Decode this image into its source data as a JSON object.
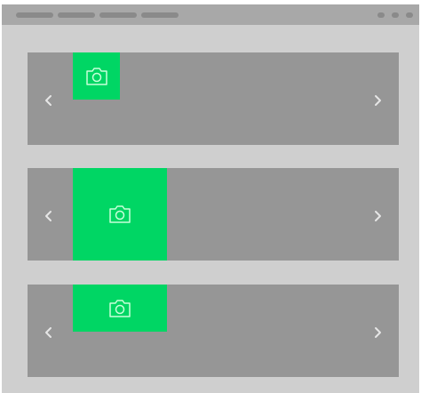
{
  "window": {
    "titlebar": {
      "tabs": [
        {
          "icon": "placeholder-tab"
        },
        {
          "icon": "placeholder-tab"
        },
        {
          "icon": "placeholder-tab"
        },
        {
          "icon": "placeholder-tab"
        }
      ],
      "controls": [
        {
          "icon": "window-control-dot"
        },
        {
          "icon": "window-control-dot"
        },
        {
          "icon": "window-control-dot"
        }
      ]
    }
  },
  "colors": {
    "page_background": "#cfcfcf",
    "titlebar": "#a8a8a8",
    "carousel_background": "#969696",
    "image_placeholder": "#00d664",
    "icon_stroke": "#c8ffd9",
    "arrow": "#e6e6e6"
  },
  "carousels": [
    {
      "prev_icon": "chevron-left-icon",
      "next_icon": "chevron-right-icon",
      "image": {
        "icon": "camera-icon",
        "aspect": "square"
      }
    },
    {
      "prev_icon": "chevron-left-icon",
      "next_icon": "chevron-right-icon",
      "image": {
        "icon": "camera-icon",
        "aspect": "square"
      }
    },
    {
      "prev_icon": "chevron-left-icon",
      "next_icon": "chevron-right-icon",
      "image": {
        "icon": "camera-icon",
        "aspect": "landscape"
      }
    }
  ]
}
